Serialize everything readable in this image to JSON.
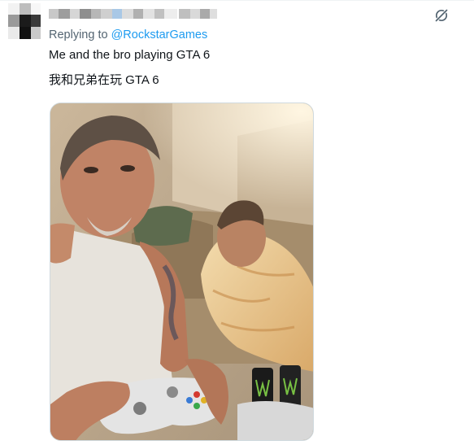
{
  "tweet": {
    "replying_prefix": "Replying to ",
    "replying_handle": "@RockstarGames",
    "text_line_1": "Me and the bro playing GTA 6",
    "text_line_2": "我和兄弟在玩 GTA 6"
  },
  "icons": {
    "grok": "grok-icon"
  },
  "colors": {
    "link": "#1d9bf0",
    "secondary_text": "#536471",
    "primary_text": "#0f1419",
    "border": "#cfd9de"
  }
}
